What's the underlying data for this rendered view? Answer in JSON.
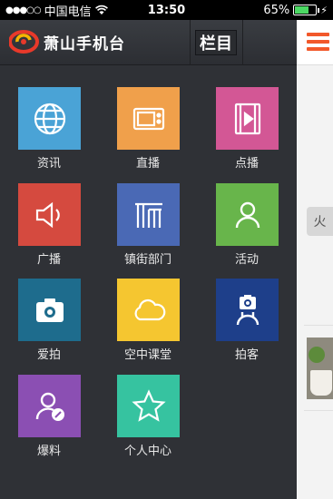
{
  "status_bar": {
    "carrier": "中国电信",
    "time": "13:50",
    "battery_percent": "65%",
    "battery_level": 0.65
  },
  "header": {
    "logo_text": "萧山手机台",
    "column_button": "栏目"
  },
  "grid": [
    {
      "label": "资讯",
      "color": "#4aa3d6",
      "icon": "globe-icon"
    },
    {
      "label": "直播",
      "color": "#f0a04b",
      "icon": "tv-icon"
    },
    {
      "label": "点播",
      "color": "#d35795",
      "icon": "film-icon"
    },
    {
      "label": "广播",
      "color": "#d54a3f",
      "icon": "speaker-icon"
    },
    {
      "label": "镇街部门",
      "color": "#4a69b5",
      "icon": "building-icon"
    },
    {
      "label": "活动",
      "color": "#68b54b",
      "icon": "person-icon"
    },
    {
      "label": "爱拍",
      "color": "#1e6c8d",
      "icon": "camera-icon"
    },
    {
      "label": "空中课堂",
      "color": "#f5c630",
      "icon": "cloud-icon"
    },
    {
      "label": "拍客",
      "color": "#1e3f8a",
      "icon": "camera-person-icon"
    },
    {
      "label": "爆料",
      "color": "#8b4fb3",
      "icon": "reporter-icon"
    },
    {
      "label": "个人中心",
      "color": "#36c3a0",
      "icon": "star-icon"
    }
  ],
  "right_panel": {
    "peek_tag": "火"
  }
}
